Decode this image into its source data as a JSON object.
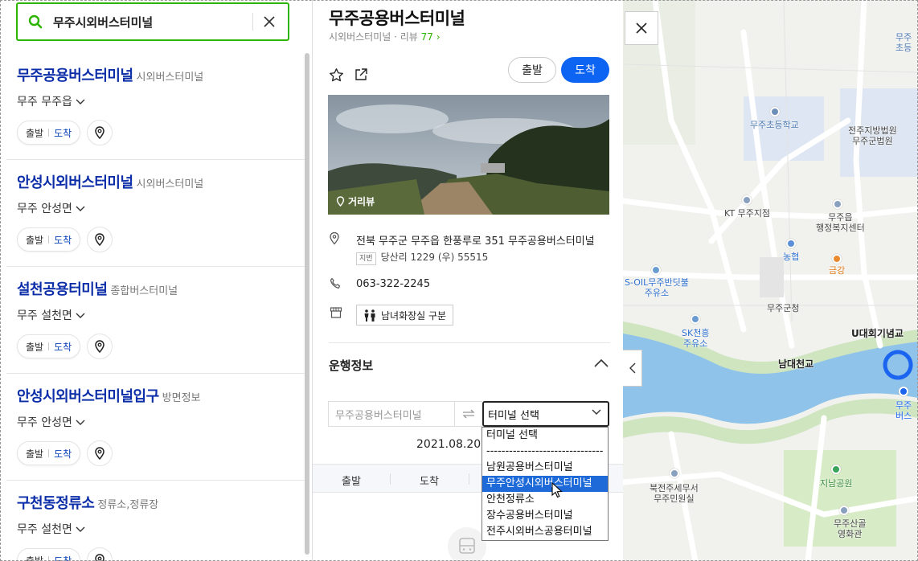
{
  "search": {
    "query": "무주시외버스터미널"
  },
  "results": [
    {
      "name": "무주공용버스터미널",
      "category": "시외버스터미널",
      "location": "무주 무주읍",
      "depart": "출발",
      "arrive": "도착"
    },
    {
      "name": "안성시외버스터미널",
      "category": "시외버스터미널",
      "location": "무주 안성면",
      "depart": "출발",
      "arrive": "도착"
    },
    {
      "name": "설천공용터미널",
      "category": "종합버스터미널",
      "location": "무주 설천면",
      "depart": "출발",
      "arrive": "도착"
    },
    {
      "name": "안성시외버스터미널입구",
      "category": "방면정보",
      "location": "무주 안성면",
      "depart": "출발",
      "arrive": "도착"
    },
    {
      "name": "구천동정류소",
      "category": "정류소,정류장",
      "location": "무주 설천면",
      "depart": "출발",
      "arrive": "도착"
    }
  ],
  "detail": {
    "title": "무주공용버스터미널",
    "category": "시외버스터미널",
    "review_label": "리뷰",
    "review_count": "77",
    "depart_btn": "출발",
    "arrive_btn": "도착",
    "street_view": "거리뷰",
    "address": "전북 무주군 무주읍 한풍루로 351 무주공용버스터미널",
    "jibun_label": "지번",
    "jibun_address": "당산리 1229 (우) 55515",
    "phone": "063-322-2245",
    "facility": "남녀화장실 구분",
    "section_title": "운행정보",
    "from_terminal": "무주공용버스터미널",
    "to_terminal": "터미널 선택",
    "date": "2021.08.20.",
    "table_headers": [
      "출발",
      "도착"
    ]
  },
  "dropdown": {
    "options": [
      "터미널 선택",
      "-------------------------------",
      "남원공용버스터미널",
      "무주안성시외버스터미널",
      "안천정류소",
      "장수공용버스터미널",
      "전주시외버스공용터미널"
    ],
    "selected_index": 3
  },
  "map": {
    "labels": {
      "school_top": "무주\n초등",
      "elem_school": "무주초등학교",
      "court": "전주지방법원\n무주군법원",
      "kt": "KT 무주지점",
      "welfare": "무주읍\n행정복지센터",
      "nonghyup": "농협",
      "geumgang": "금강",
      "soil": "S-OIL무주반딧불\n주유소",
      "county": "무주군청",
      "sk": "SK천흥\n주유소",
      "bridge_u": "U대회기념교",
      "namdae": "남대천교",
      "terminal_short": "무주\n버스",
      "tax": "북전주세무서\n무주민원실",
      "park": "지남공원",
      "cinema": "무주산골\n영화관"
    }
  }
}
